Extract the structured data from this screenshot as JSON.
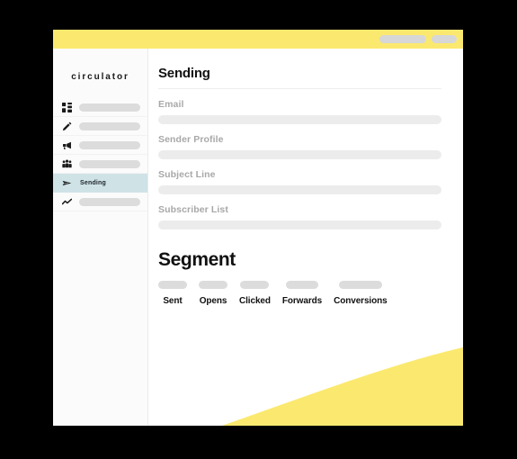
{
  "window": {
    "accent_color": "#fbe96f",
    "controls": [
      {
        "name": "window-control-wide"
      },
      {
        "name": "window-control-small"
      }
    ]
  },
  "sidebar": {
    "brand": "circulator",
    "active_color": "#cfe3e7",
    "items": [
      {
        "icon": "dashboard-grid-icon",
        "label": "",
        "active": false
      },
      {
        "icon": "pencil-edit-icon",
        "label": "",
        "active": false
      },
      {
        "icon": "megaphone-icon",
        "label": "",
        "active": false
      },
      {
        "icon": "people-group-icon",
        "label": "",
        "active": false
      },
      {
        "icon": "paper-plane-icon",
        "label": "Sending",
        "active": true
      },
      {
        "icon": "analytics-line-icon",
        "label": "",
        "active": false
      }
    ]
  },
  "main": {
    "page_title": "Sending",
    "fields": [
      {
        "label": "Email",
        "value": "",
        "placeholder": ""
      },
      {
        "label": "Sender Profile",
        "value": "",
        "placeholder": ""
      },
      {
        "label": "Subject Line",
        "value": "",
        "placeholder": ""
      },
      {
        "label": "Subscriber List",
        "value": "",
        "placeholder": ""
      }
    ],
    "segment": {
      "title": "Segment",
      "stats": [
        {
          "label": "Sent",
          "value": ""
        },
        {
          "label": "Opens",
          "value": ""
        },
        {
          "label": "Clicked",
          "value": ""
        },
        {
          "label": "Forwards",
          "value": ""
        },
        {
          "label": "Conversions",
          "value": ""
        }
      ]
    }
  }
}
